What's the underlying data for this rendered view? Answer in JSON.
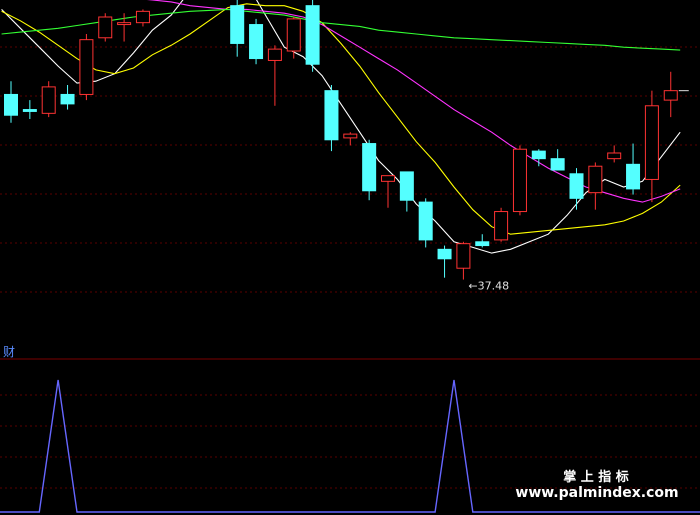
{
  "chart_data": [
    {
      "type": "candlestick",
      "price_range": [
        34.0,
        52.0
      ],
      "candles": [
        {
          "o": 47.0,
          "h": 47.7,
          "l": 45.5,
          "c": 45.9
        },
        {
          "o": 46.2,
          "h": 46.7,
          "l": 45.7,
          "c": 46.1
        },
        {
          "o": 46.0,
          "h": 47.7,
          "l": 45.8,
          "c": 47.4
        },
        {
          "o": 47.0,
          "h": 47.5,
          "l": 46.2,
          "c": 46.5
        },
        {
          "o": 47.0,
          "h": 50.2,
          "l": 46.7,
          "c": 49.9
        },
        {
          "o": 50.0,
          "h": 51.3,
          "l": 49.8,
          "c": 51.1
        },
        {
          "o": 50.7,
          "h": 51.3,
          "l": 49.8,
          "c": 50.8
        },
        {
          "o": 50.8,
          "h": 51.5,
          "l": 50.6,
          "c": 51.4
        },
        {
          "o": 53.1,
          "h": 54.0,
          "l": 52.5,
          "c": 54.0
        },
        {
          "o": 53.0,
          "h": 54.3,
          "l": 52.8,
          "c": 54.1
        },
        {
          "o": 54.0,
          "h": 54.2,
          "l": 52.7,
          "c": 53.0
        },
        {
          "o": 52.8,
          "h": 53.1,
          "l": 52.2,
          "c": 52.3
        },
        {
          "o": 51.7,
          "h": 52.5,
          "l": 49.0,
          "c": 49.7
        },
        {
          "o": 50.7,
          "h": 51.0,
          "l": 48.6,
          "c": 48.9
        },
        {
          "o": 48.8,
          "h": 49.6,
          "l": 46.4,
          "c": 49.4
        },
        {
          "o": 49.3,
          "h": 51.1,
          "l": 48.9,
          "c": 51.0
        },
        {
          "o": 51.7,
          "h": 52.7,
          "l": 48.2,
          "c": 48.6
        },
        {
          "o": 47.2,
          "h": 47.5,
          "l": 44.0,
          "c": 44.6
        },
        {
          "o": 44.7,
          "h": 45.0,
          "l": 44.3,
          "c": 44.9
        },
        {
          "o": 44.4,
          "h": 44.6,
          "l": 41.4,
          "c": 41.9
        },
        {
          "o": 42.4,
          "h": 42.7,
          "l": 41.0,
          "c": 42.7
        },
        {
          "o": 42.9,
          "h": 42.9,
          "l": 40.8,
          "c": 41.4
        },
        {
          "o": 41.3,
          "h": 41.5,
          "l": 38.9,
          "c": 39.3
        },
        {
          "o": 38.8,
          "h": 39.0,
          "l": 37.3,
          "c": 38.3
        },
        {
          "o": 37.8,
          "h": 39.2,
          "l": 37.2,
          "c": 39.1
        },
        {
          "o": 39.2,
          "h": 39.6,
          "l": 38.9,
          "c": 39.0
        },
        {
          "o": 39.3,
          "h": 41.0,
          "l": 39.2,
          "c": 40.8
        },
        {
          "o": 40.8,
          "h": 44.3,
          "l": 40.6,
          "c": 44.1
        },
        {
          "o": 44.0,
          "h": 44.1,
          "l": 43.2,
          "c": 43.6
        },
        {
          "o": 43.6,
          "h": 44.1,
          "l": 43.0,
          "c": 43.0
        },
        {
          "o": 42.8,
          "h": 43.1,
          "l": 40.9,
          "c": 41.5
        },
        {
          "o": 41.8,
          "h": 43.4,
          "l": 40.9,
          "c": 43.2
        },
        {
          "o": 43.6,
          "h": 44.3,
          "l": 43.4,
          "c": 43.9
        },
        {
          "o": 43.3,
          "h": 44.4,
          "l": 41.7,
          "c": 42.0
        },
        {
          "o": 42.5,
          "h": 47.2,
          "l": 41.3,
          "c": 46.4
        },
        {
          "o": 46.7,
          "h": 48.2,
          "l": 45.8,
          "c": 47.2
        }
      ],
      "ma_lines": [
        {
          "color": "#ffffff",
          "values": [
            51.5,
            50.5,
            49.5,
            48.5,
            47.6,
            47.7,
            48.1,
            49.2,
            50.4,
            51.2,
            52.5,
            53.2,
            53.5,
            52.9,
            51.2,
            49.5,
            49.0,
            48.0,
            46.5,
            45.0,
            43.5,
            42.5,
            41.2,
            40.3,
            39.2,
            38.9,
            38.6,
            38.8,
            39.2,
            39.6,
            40.6,
            41.8,
            42.5,
            42.1,
            42.4,
            43.7,
            45.0
          ]
        },
        {
          "color": "#ffff00",
          "values": [
            51.4,
            50.9,
            50.3,
            49.6,
            48.9,
            48.3,
            48.1,
            48.4,
            49.1,
            49.6,
            50.2,
            50.9,
            51.6,
            51.8,
            51.7,
            51.7,
            51.4,
            50.8,
            49.7,
            48.5,
            47.1,
            45.8,
            44.5,
            43.4,
            42.1,
            40.9,
            40.0,
            39.6,
            39.7,
            39.8,
            39.9,
            40.0,
            40.1,
            40.3,
            40.7,
            41.3,
            42.2
          ]
        },
        {
          "color": "#ff33ff",
          "values": [
            52.4,
            52.4,
            52.35,
            52.3,
            52.3,
            52.25,
            52.2,
            52.1,
            52.0,
            51.9,
            51.7,
            51.6,
            51.5,
            51.5,
            51.4,
            51.3,
            51.1,
            50.7,
            50.1,
            49.5,
            48.9,
            48.3,
            47.6,
            46.9,
            46.2,
            45.6,
            45.0,
            44.3,
            43.7,
            43.1,
            42.6,
            42.1,
            41.8,
            41.5,
            41.3,
            41.6,
            42.0
          ]
        },
        {
          "color": "#33ff33",
          "values": [
            50.2,
            50.3,
            50.4,
            50.5,
            50.65,
            50.8,
            50.95,
            51.1,
            51.2,
            51.3,
            51.4,
            51.45,
            51.5,
            51.4,
            51.3,
            51.2,
            51.0,
            50.8,
            50.7,
            50.6,
            50.4,
            50.3,
            50.2,
            50.1,
            50.0,
            49.95,
            49.9,
            49.85,
            49.8,
            49.75,
            49.7,
            49.65,
            49.6,
            49.5,
            49.45,
            49.4,
            49.35
          ]
        }
      ],
      "annotation": "37.48"
    },
    {
      "type": "line",
      "title": "财",
      "color": "#6666ff",
      "values": [
        0,
        0,
        0,
        1,
        0,
        0,
        0,
        0,
        0,
        0,
        0,
        0,
        0,
        0,
        0,
        0,
        0,
        0,
        0,
        0,
        0,
        0,
        0,
        0,
        1,
        0,
        0,
        0,
        0,
        0,
        0,
        0,
        0,
        0,
        0,
        0,
        0
      ]
    }
  ],
  "watermark": {
    "line1": "掌 上 指 标",
    "line2": "www.palmindex.com"
  },
  "colors": {
    "up": "#ff3333",
    "down": "#54ffff",
    "grid": "#5a0000"
  }
}
